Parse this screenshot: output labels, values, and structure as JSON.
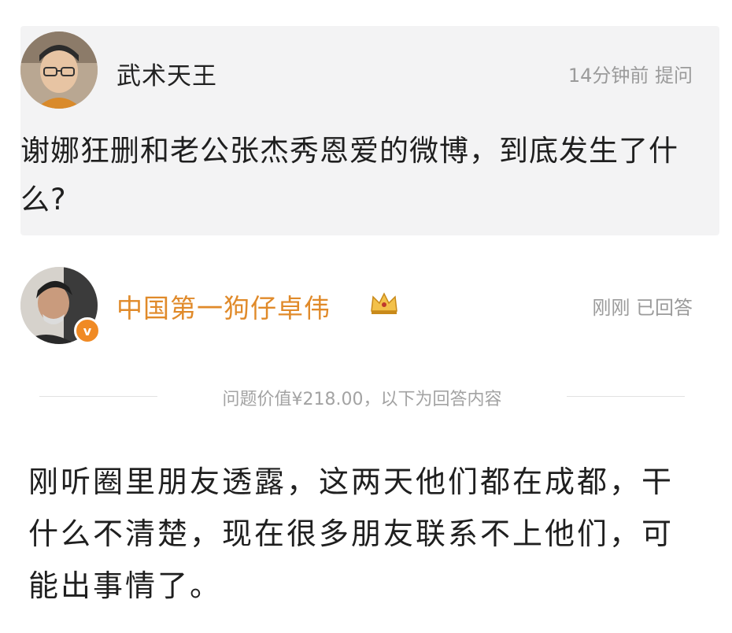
{
  "question": {
    "asker_name": "武术天王",
    "time": "14分钟前",
    "action": "提问",
    "text": "谢娜狂删和老公张杰秀恩爱的微博，到底发生了什么?"
  },
  "answer": {
    "answerer_name": "中国第一狗仔卓伟",
    "verified_badge": "v",
    "time": "刚刚",
    "status": "已回答",
    "value_text": "问题价值¥218.00，以下为回答内容",
    "text": "刚听圈里朋友透露，这两天他们都在成都，干什么不清楚，现在很多朋友联系不上他们，可能出事情了。"
  },
  "colors": {
    "question_bg": "#f3f3f4",
    "answerer_name": "#e08a2a",
    "badge": "#f08a24",
    "meta_text": "#9b9b9b"
  },
  "icons": {
    "crown": "crown-icon",
    "verified": "verified-badge-icon"
  }
}
